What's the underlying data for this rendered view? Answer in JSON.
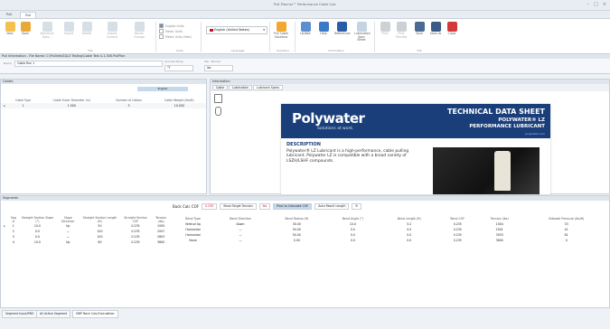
{
  "window": {
    "title": "Pull-Planner™ Performance Cable Calc"
  },
  "menu_tabs": [
    {
      "label": "Pull"
    },
    {
      "label": "Pull"
    }
  ],
  "ribbon": {
    "buttons": [
      {
        "label": "New"
      },
      {
        "label": "Open"
      },
      {
        "label": "Maximize Data..."
      },
      {
        "label": "Import"
      },
      {
        "label": "Delete"
      },
      {
        "label": "Import Conduit"
      },
      {
        "label": "Recalc Change"
      },
      {
        "label": "Pull Cable Solutions"
      },
      {
        "label": "Update"
      },
      {
        "label": "Help"
      },
      {
        "label": "References"
      },
      {
        "label": "Lubrication Spec Sheet"
      },
      {
        "label": "Print"
      },
      {
        "label": "Print Preview"
      },
      {
        "label": "Save"
      },
      {
        "label": "Save as"
      },
      {
        "label": "Close"
      }
    ],
    "checkboxes": [
      {
        "label": "English Units",
        "checked": true
      },
      {
        "label": "Metric Units",
        "checked": false
      },
      {
        "label": "Metric Units (feet)",
        "checked": false
      }
    ],
    "language": "English (United States)",
    "groups": [
      "File",
      "Units",
      "Language",
      "Solutions",
      "Information",
      "File"
    ]
  },
  "pull_info": {
    "header": "Pull Information - File Name: C:\\PullInfo\\SQLX Testing\\Cable Test 4-1-500.PullPlan",
    "name_label": "Name",
    "name_value": "Cable Run 1",
    "temp_label": "Conduit Temp",
    "temp_value": "°F",
    "min_label": "Min. Tension",
    "min_value": "lbs"
  },
  "cables": {
    "header": "Cables",
    "unit_label": "English",
    "columns": [
      "Cable Type",
      "Cable Outer Diameter (in)",
      "Number of Cables",
      "Cable Weight (lbs/ft)"
    ],
    "rows": [
      {
        "type": "1",
        "od": "1.500",
        "n": "3",
        "w": "10.000"
      }
    ]
  },
  "information": {
    "header": "Information",
    "tabs": [
      {
        "label": "Cable"
      },
      {
        "label": "Lubrication"
      },
      {
        "label": "Lubricant Specs"
      }
    ],
    "document": {
      "logo": "Polywater",
      "tagline": "Solutions at work.",
      "title1": "TECHNICAL DATA SHEET",
      "title2": "POLYWATER® LZ",
      "title3": "PERFORMANCE LUBRICANT",
      "website": "polywater.com",
      "desc_heading": "DESCRIPTION",
      "desc_text": "Polywater® LZ Lubricant is a high-performance, cable pulling lubricant. Polywater LZ is compatible with a broad variety of LSZH/LSHF compounds."
    }
  },
  "segments": {
    "header": "Segments",
    "toolbar": {
      "coef_label": "Back Calc COF",
      "coef_value": "0.235",
      "target_label": "Show Target Tension",
      "target_value": "lbs",
      "back_label": "Prior to Calculate COF",
      "pull_label": "Auto Result Length",
      "pull_value": "ft"
    },
    "left_columns": [
      "Seg #",
      "Straight Section Slope (°)",
      "Slope Direction",
      "Straight Section Length (ft)",
      "Straight Section COF",
      "Tension (lbs)"
    ],
    "left_rows": [
      [
        "1",
        "10.0",
        "Up",
        "50",
        "0.235",
        "1000"
      ],
      [
        "2",
        "0.0",
        "—",
        "100",
        "0.235",
        "2007"
      ],
      [
        "3",
        "0.0",
        "—",
        "100",
        "0.235",
        "2803"
      ],
      [
        "4",
        "10.0",
        "Up",
        "60",
        "0.235",
        "3600"
      ]
    ],
    "right_columns": [
      "Bend Type",
      "Bend Direction",
      "Bend Radius (ft)",
      "Bend Angle (°)",
      "Bend Length (ft)",
      "Bend COF",
      "Tension (lbs)",
      "Sidewall Pressure (lbs/ft)"
    ],
    "right_rows": [
      [
        "Vertical Up",
        "Down",
        "30.00",
        "10.0",
        "5.2",
        "0.235",
        "1004",
        "33"
      ],
      [
        "Horizontal",
        "—",
        "50.00",
        "0.0",
        "0.0",
        "0.235",
        "2041",
        "41"
      ],
      [
        "Horizontal",
        "—",
        "50.00",
        "0.0",
        "0.0",
        "0.235",
        "3033",
        "61"
      ],
      [
        "None",
        "—",
        "0.00",
        "0.0",
        "0.0",
        "0.235",
        "3600",
        "0"
      ]
    ]
  },
  "bottom_tabs": [
    {
      "label": "Segment Input/PNG"
    },
    {
      "label": "All Active Segment"
    },
    {
      "label": "SWP Back Calc/Calculation"
    }
  ]
}
